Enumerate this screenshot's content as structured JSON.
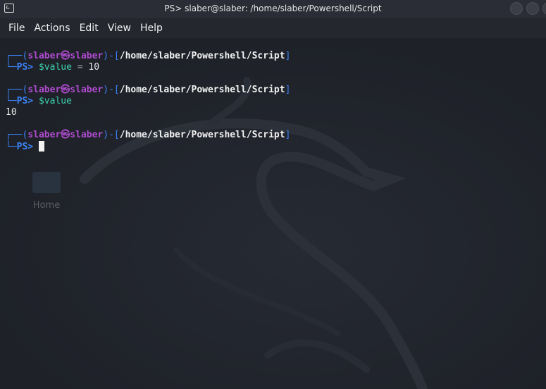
{
  "window": {
    "title": "PS> slaber@slaber: /home/slaber/Powershell/Script"
  },
  "menu": {
    "items": [
      "File",
      "Actions",
      "Edit",
      "View",
      "Help"
    ]
  },
  "desktop": {
    "home_label": "Home"
  },
  "prompt": {
    "open": "┌──(",
    "user": "slaber",
    "at": "㉿",
    "host": "slaber",
    "mid": ")-[",
    "path": "/home/slaber/Powershell/Script",
    "close": "]",
    "ps_prefix": "└─",
    "ps": "PS>"
  },
  "commands": [
    {
      "var": "$value",
      "op": " = ",
      "value": "10"
    },
    {
      "var": "$value"
    }
  ],
  "output": [
    "10"
  ],
  "colors": {
    "prompt_line": "#3b82f6",
    "user_host": "#b04bd0",
    "path": "#f2f2f2",
    "variable": "#3dd2b0"
  }
}
